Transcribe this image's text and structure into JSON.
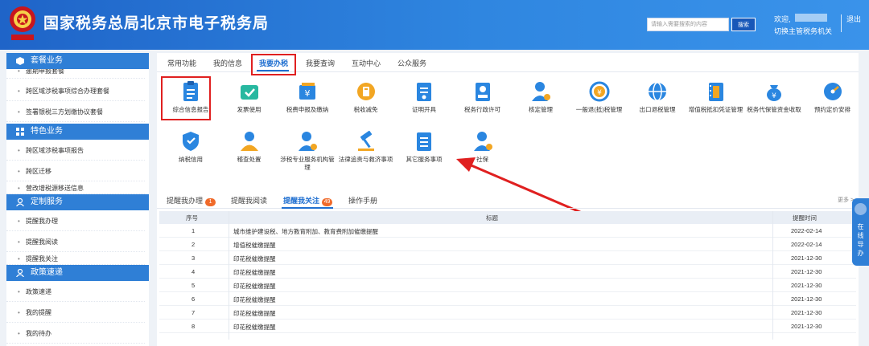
{
  "header": {
    "title": "国家税务总局北京市电子税务局",
    "search_placeholder": "请输入需要搜索的内容",
    "search_button": "搜索",
    "welcome": "欢迎,",
    "switch_label": "切换主管税务机关",
    "logout": "退出"
  },
  "sidebar": {
    "sections": [
      {
        "title": "套餐业务",
        "items": [
          "逾期申报套餐",
          "跨区域涉税事项综合办理套餐",
          "签署银税三方划缴协议套餐"
        ]
      },
      {
        "title": "特色业务",
        "items": [
          "跨区域涉税事项报告",
          "跨区迁移",
          "营改增税源移送信息"
        ]
      },
      {
        "title": "定制服务",
        "items": [
          "提醒我办理",
          "提醒我阅读",
          "提醒我关注"
        ]
      },
      {
        "title": "政策速递",
        "items": [
          "政策速递",
          "我的提醒",
          "我的待办"
        ]
      }
    ]
  },
  "tabs": [
    "常用功能",
    "我的信息",
    "我要办税",
    "我要查询",
    "互动中心",
    "公众服务"
  ],
  "icons": [
    {
      "label": "综合信息报告",
      "icon": "clipboard-icon",
      "color": "#2a86e0"
    },
    {
      "label": "发票使用",
      "icon": "ticket-icon",
      "color": "#28b8a0"
    },
    {
      "label": "税费申报及缴纳",
      "icon": "yuan-card-icon",
      "color": "#2a86e0"
    },
    {
      "label": "税收减免",
      "icon": "coin-icon",
      "color": "#f2a623"
    },
    {
      "label": "证明开具",
      "icon": "certificate-icon",
      "color": "#2a86e0"
    },
    {
      "label": "税务行政许可",
      "icon": "person-card-icon",
      "color": "#2a86e0"
    },
    {
      "label": "核定管理",
      "icon": "user-gear-icon",
      "color": "#2a86e0"
    },
    {
      "label": "一般退(抵)税管理",
      "icon": "refund-icon",
      "color": "#f2a623"
    },
    {
      "label": "出口退税管理",
      "icon": "globe-icon",
      "color": "#2a86e0"
    },
    {
      "label": "增值税抵扣凭证管理",
      "icon": "film-icon",
      "color": "#2a86e0"
    },
    {
      "label": "税务代保管资金收取",
      "icon": "money-bag-icon",
      "color": "#2a86e0"
    },
    {
      "label": "预约定价安排",
      "icon": "dial-icon",
      "color": "#2a86e0"
    },
    {
      "label": "纳税信用",
      "icon": "heart-shield-icon",
      "color": "#2a86e0"
    },
    {
      "label": "稽查处置",
      "icon": "inspector-icon",
      "color": "#2a86e0"
    },
    {
      "label": "涉税专业服务机构管理",
      "icon": "agent-icon",
      "color": "#2a86e0"
    },
    {
      "label": "法律追责与救济事项",
      "icon": "gavel-icon",
      "color": "#2a86e0"
    },
    {
      "label": "其它服务事项",
      "icon": "list-icon",
      "color": "#2a86e0"
    },
    {
      "label": "社保",
      "icon": "social-security-icon",
      "color": "#2a86e0"
    }
  ],
  "sub_tabs": [
    {
      "label": "提醒我办理",
      "badge": "1"
    },
    {
      "label": "提醒我阅读",
      "badge": ""
    },
    {
      "label": "提醒我关注",
      "badge": "49"
    },
    {
      "label": "操作手册",
      "badge": ""
    }
  ],
  "more": "更多 >",
  "table": {
    "headers": [
      "序号",
      "标题",
      "提醒时间"
    ],
    "rows": [
      {
        "no": "1",
        "title": "城市维护建设税、地方教育附加、教育费附加催缴提醒",
        "date": "2022-02-14"
      },
      {
        "no": "2",
        "title": "增值税催缴提醒",
        "date": "2022-02-14"
      },
      {
        "no": "3",
        "title": "印花税催缴提醒",
        "date": "2021-12-30"
      },
      {
        "no": "4",
        "title": "印花税催缴提醒",
        "date": "2021-12-30"
      },
      {
        "no": "5",
        "title": "印花税催缴提醒",
        "date": "2021-12-30"
      },
      {
        "no": "6",
        "title": "印花税催缴提醒",
        "date": "2021-12-30"
      },
      {
        "no": "7",
        "title": "印花税催缴提醒",
        "date": "2021-12-30"
      },
      {
        "no": "8",
        "title": "印花税催缴提醒",
        "date": "2021-12-30"
      }
    ]
  },
  "float_nav": "在线导办"
}
